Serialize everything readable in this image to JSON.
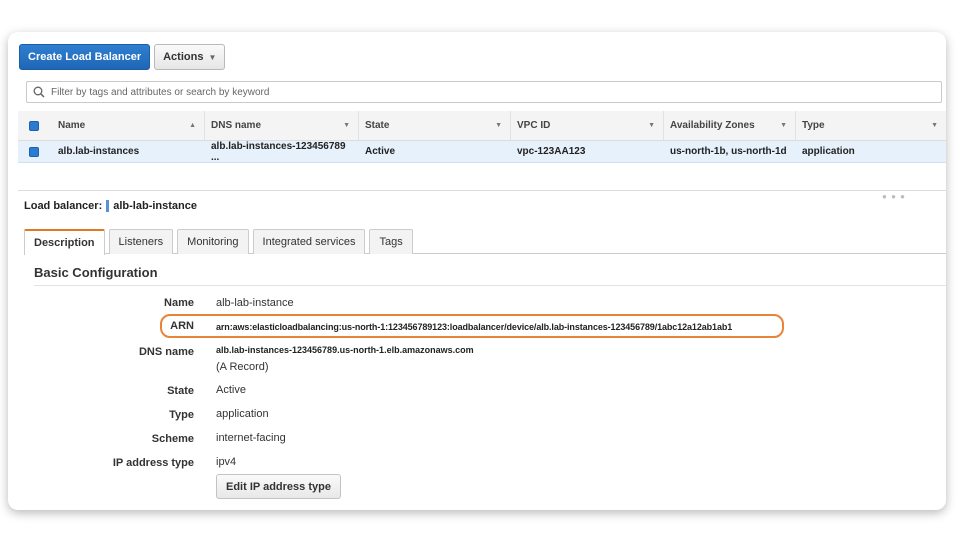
{
  "toolbar": {
    "create_label": "Create Load Balancer",
    "actions_label": "Actions"
  },
  "filter": {
    "placeholder": "Filter by tags and attributes or search by keyword"
  },
  "table": {
    "columns": [
      "Name",
      "DNS name",
      "State",
      "VPC ID",
      "Availability Zones",
      "Type"
    ],
    "rows": [
      [
        "alb.lab-instances",
        "alb.lab-instances-123456789 ...",
        "Active",
        "vpc-123AA123",
        "us-north-1b, us-north-1d",
        "application"
      ]
    ]
  },
  "detail": {
    "title_prefix": "Load balancer:",
    "lb_name": "alb-lab-instance",
    "tabs": [
      "Description",
      "Listeners",
      "Monitoring",
      "Integrated services",
      "Tags"
    ],
    "active_tab": "Description",
    "section_title": "Basic Configuration",
    "fields": {
      "name_label": "Name",
      "name_value": "alb-lab-instance",
      "arn_label": "ARN",
      "arn_value": "arn:aws:elasticloadbalancing:us-north-1:123456789123:loadbalancer/device/alb.lab-instances-123456789/1abc12a12ab1ab1",
      "dns_label": "DNS name",
      "dns_value": "alb.lab-instances-123456789.us-north-1.elb.amazonaws.com",
      "dns_note": "(A Record)",
      "state_label": "State",
      "state_value": "Active",
      "type_label": "Type",
      "type_value": "application",
      "scheme_label": "Scheme",
      "scheme_value": "internet-facing",
      "ip_label": "IP address type",
      "ip_value": "ipv4"
    },
    "edit_ip_label": "Edit IP address type"
  },
  "colors": {
    "primary": "#2a73c7",
    "highlight": "#e8833a",
    "selected_row": "#e7f1fb"
  }
}
